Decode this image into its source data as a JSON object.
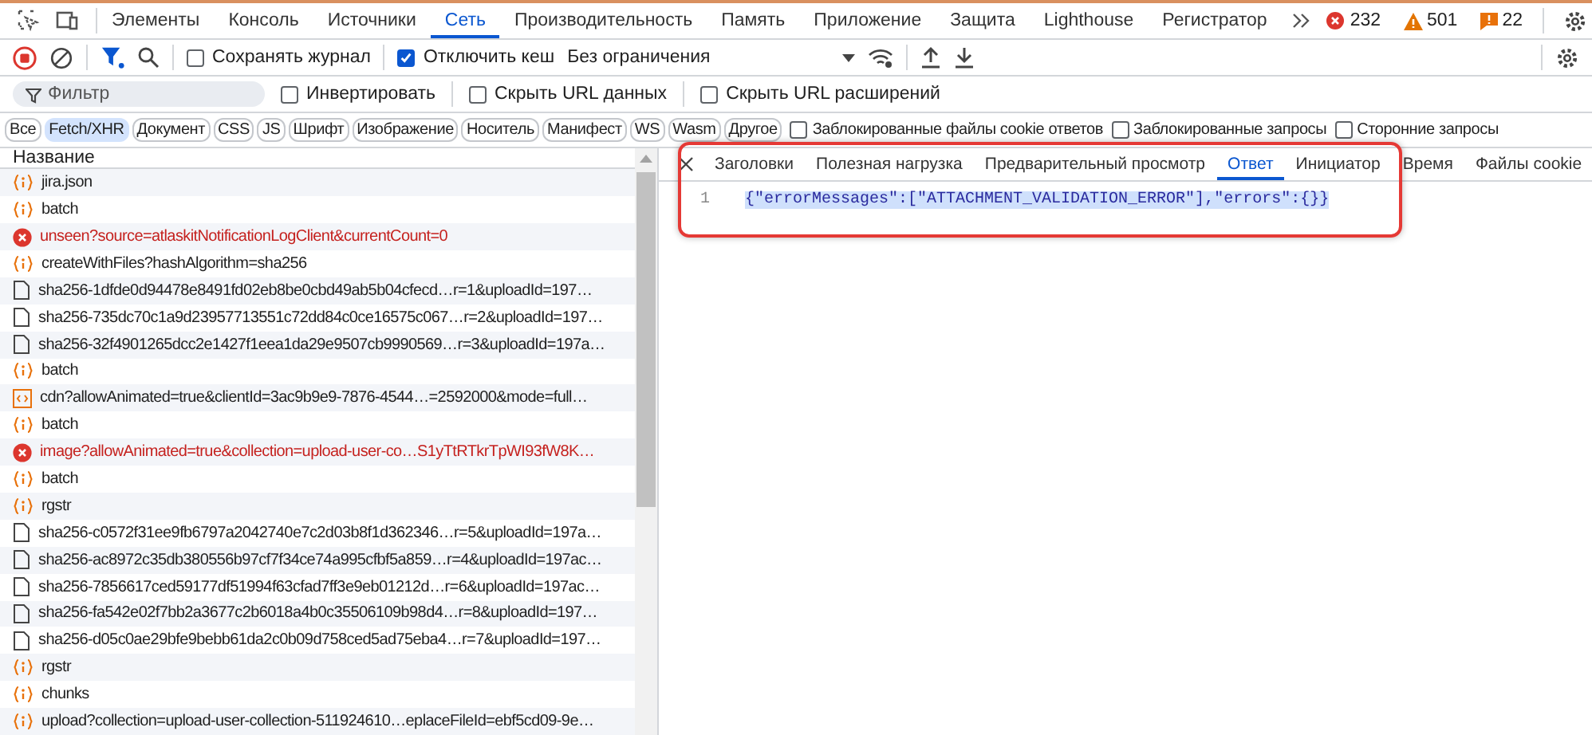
{
  "panel_tabs": [
    {
      "label": "Элементы",
      "selected": false
    },
    {
      "label": "Консоль",
      "selected": false
    },
    {
      "label": "Источники",
      "selected": false
    },
    {
      "label": "Сеть",
      "selected": true
    },
    {
      "label": "Производительность",
      "selected": false
    },
    {
      "label": "Память",
      "selected": false
    },
    {
      "label": "Приложение",
      "selected": false
    },
    {
      "label": "Защита",
      "selected": false
    },
    {
      "label": "Lighthouse",
      "selected": false
    },
    {
      "label": "Регистратор",
      "selected": false
    }
  ],
  "counts": {
    "errors": "232",
    "warnings": "501",
    "issues": "22"
  },
  "toolbar": {
    "preserve_log": {
      "label": "Сохранять журнал",
      "checked": false
    },
    "disable_cache": {
      "label": "Отключить кеш",
      "checked": true
    },
    "throttling": "Без ограничения"
  },
  "filter": {
    "placeholder": "Фильтр",
    "options": [
      {
        "label": "Инвертировать",
        "checked": false
      },
      {
        "label": "Скрыть URL данных",
        "checked": false
      },
      {
        "label": "Скрыть URL расширений",
        "checked": false
      }
    ]
  },
  "type_chips": [
    {
      "label": "Все",
      "selected": false
    },
    {
      "label": "Fetch/XHR",
      "selected": true
    },
    {
      "label": "Документ",
      "selected": false
    },
    {
      "label": "CSS",
      "selected": false
    },
    {
      "label": "JS",
      "selected": false
    },
    {
      "label": "Шрифт",
      "selected": false
    },
    {
      "label": "Изображение",
      "selected": false
    },
    {
      "label": "Носитель",
      "selected": false
    },
    {
      "label": "Манифест",
      "selected": false
    },
    {
      "label": "WS",
      "selected": false
    },
    {
      "label": "Wasm",
      "selected": false
    },
    {
      "label": "Другое",
      "selected": false
    }
  ],
  "chip_options": [
    {
      "label": "Заблокированные файлы cookie ответов",
      "checked": false
    },
    {
      "label": "Заблокированные запросы",
      "checked": false
    },
    {
      "label": "Сторонние запросы",
      "checked": false
    }
  ],
  "requests": {
    "column": "Название",
    "rows": [
      {
        "name": "jira.json",
        "kind": "xhr"
      },
      {
        "name": "batch",
        "kind": "xhr"
      },
      {
        "name": "unseen?source=atlaskitNotificationLogClient&currentCount=0",
        "kind": "error"
      },
      {
        "name": "createWithFiles?hashAlgorithm=sha256",
        "kind": "xhr"
      },
      {
        "name": "sha256-1dfde0d94478e8491fd02eb8be0cbd49ab5b04cfecd…r=1&uploadId=197…",
        "kind": "doc"
      },
      {
        "name": "sha256-735dc70c1a9d23957713551c72dd84c0ce16575c067…r=2&uploadId=197…",
        "kind": "doc"
      },
      {
        "name": "sha256-32f4901265dcc2e1427f1eea1da29e9507cb9990569…r=3&uploadId=197a…",
        "kind": "doc"
      },
      {
        "name": "batch",
        "kind": "xhr"
      },
      {
        "name": "cdn?allowAnimated=true&clientId=3ac9b9e9-7876-4544…=2592000&mode=full…",
        "kind": "image"
      },
      {
        "name": "batch",
        "kind": "xhr"
      },
      {
        "name": "image?allowAnimated=true&collection=upload-user-co…S1yTtRTkrTpWI93fW8K…",
        "kind": "error"
      },
      {
        "name": "batch",
        "kind": "xhr"
      },
      {
        "name": "rgstr",
        "kind": "xhr"
      },
      {
        "name": "sha256-c0572f31ee9fb6797a2042740e7c2d03b8f1d362346…r=5&uploadId=197a…",
        "kind": "doc"
      },
      {
        "name": "sha256-ac8972c35db380556b97cf7f34ce74a995cfbf5a859…r=4&uploadId=197ac…",
        "kind": "doc"
      },
      {
        "name": "sha256-7856617ced59177df51994f63cfad7ff3e9eb01212d…r=6&uploadId=197ac…",
        "kind": "doc"
      },
      {
        "name": "sha256-fa542e02f7bb2a3677c2b6018a4b0c35506109b98d4…r=8&uploadId=197…",
        "kind": "doc"
      },
      {
        "name": "sha256-d05c0ae29bfe9bebb61da2c0b09d758ced5ad75eba4…r=7&uploadId=197…",
        "kind": "doc"
      },
      {
        "name": "rgstr",
        "kind": "xhr"
      },
      {
        "name": "chunks",
        "kind": "xhr"
      },
      {
        "name": "upload?collection=upload-user-collection-511924610…eplaceFileId=ebf5cd09-9e…",
        "kind": "xhr"
      }
    ]
  },
  "detail": {
    "tabs": [
      {
        "label": "Заголовки",
        "selected": false
      },
      {
        "label": "Полезная нагрузка",
        "selected": false
      },
      {
        "label": "Предварительный просмотр",
        "selected": false
      },
      {
        "label": "Ответ",
        "selected": true
      },
      {
        "label": "Инициатор",
        "selected": false
      },
      {
        "label": "Время",
        "selected": false
      },
      {
        "label": "Файлы cookie",
        "selected": false
      }
    ],
    "lines": [
      {
        "number": "1",
        "text": "{\"errorMessages\":[\"ATTACHMENT_VALIDATION_ERROR\"],\"errors\":{}}",
        "selected": true
      }
    ]
  }
}
